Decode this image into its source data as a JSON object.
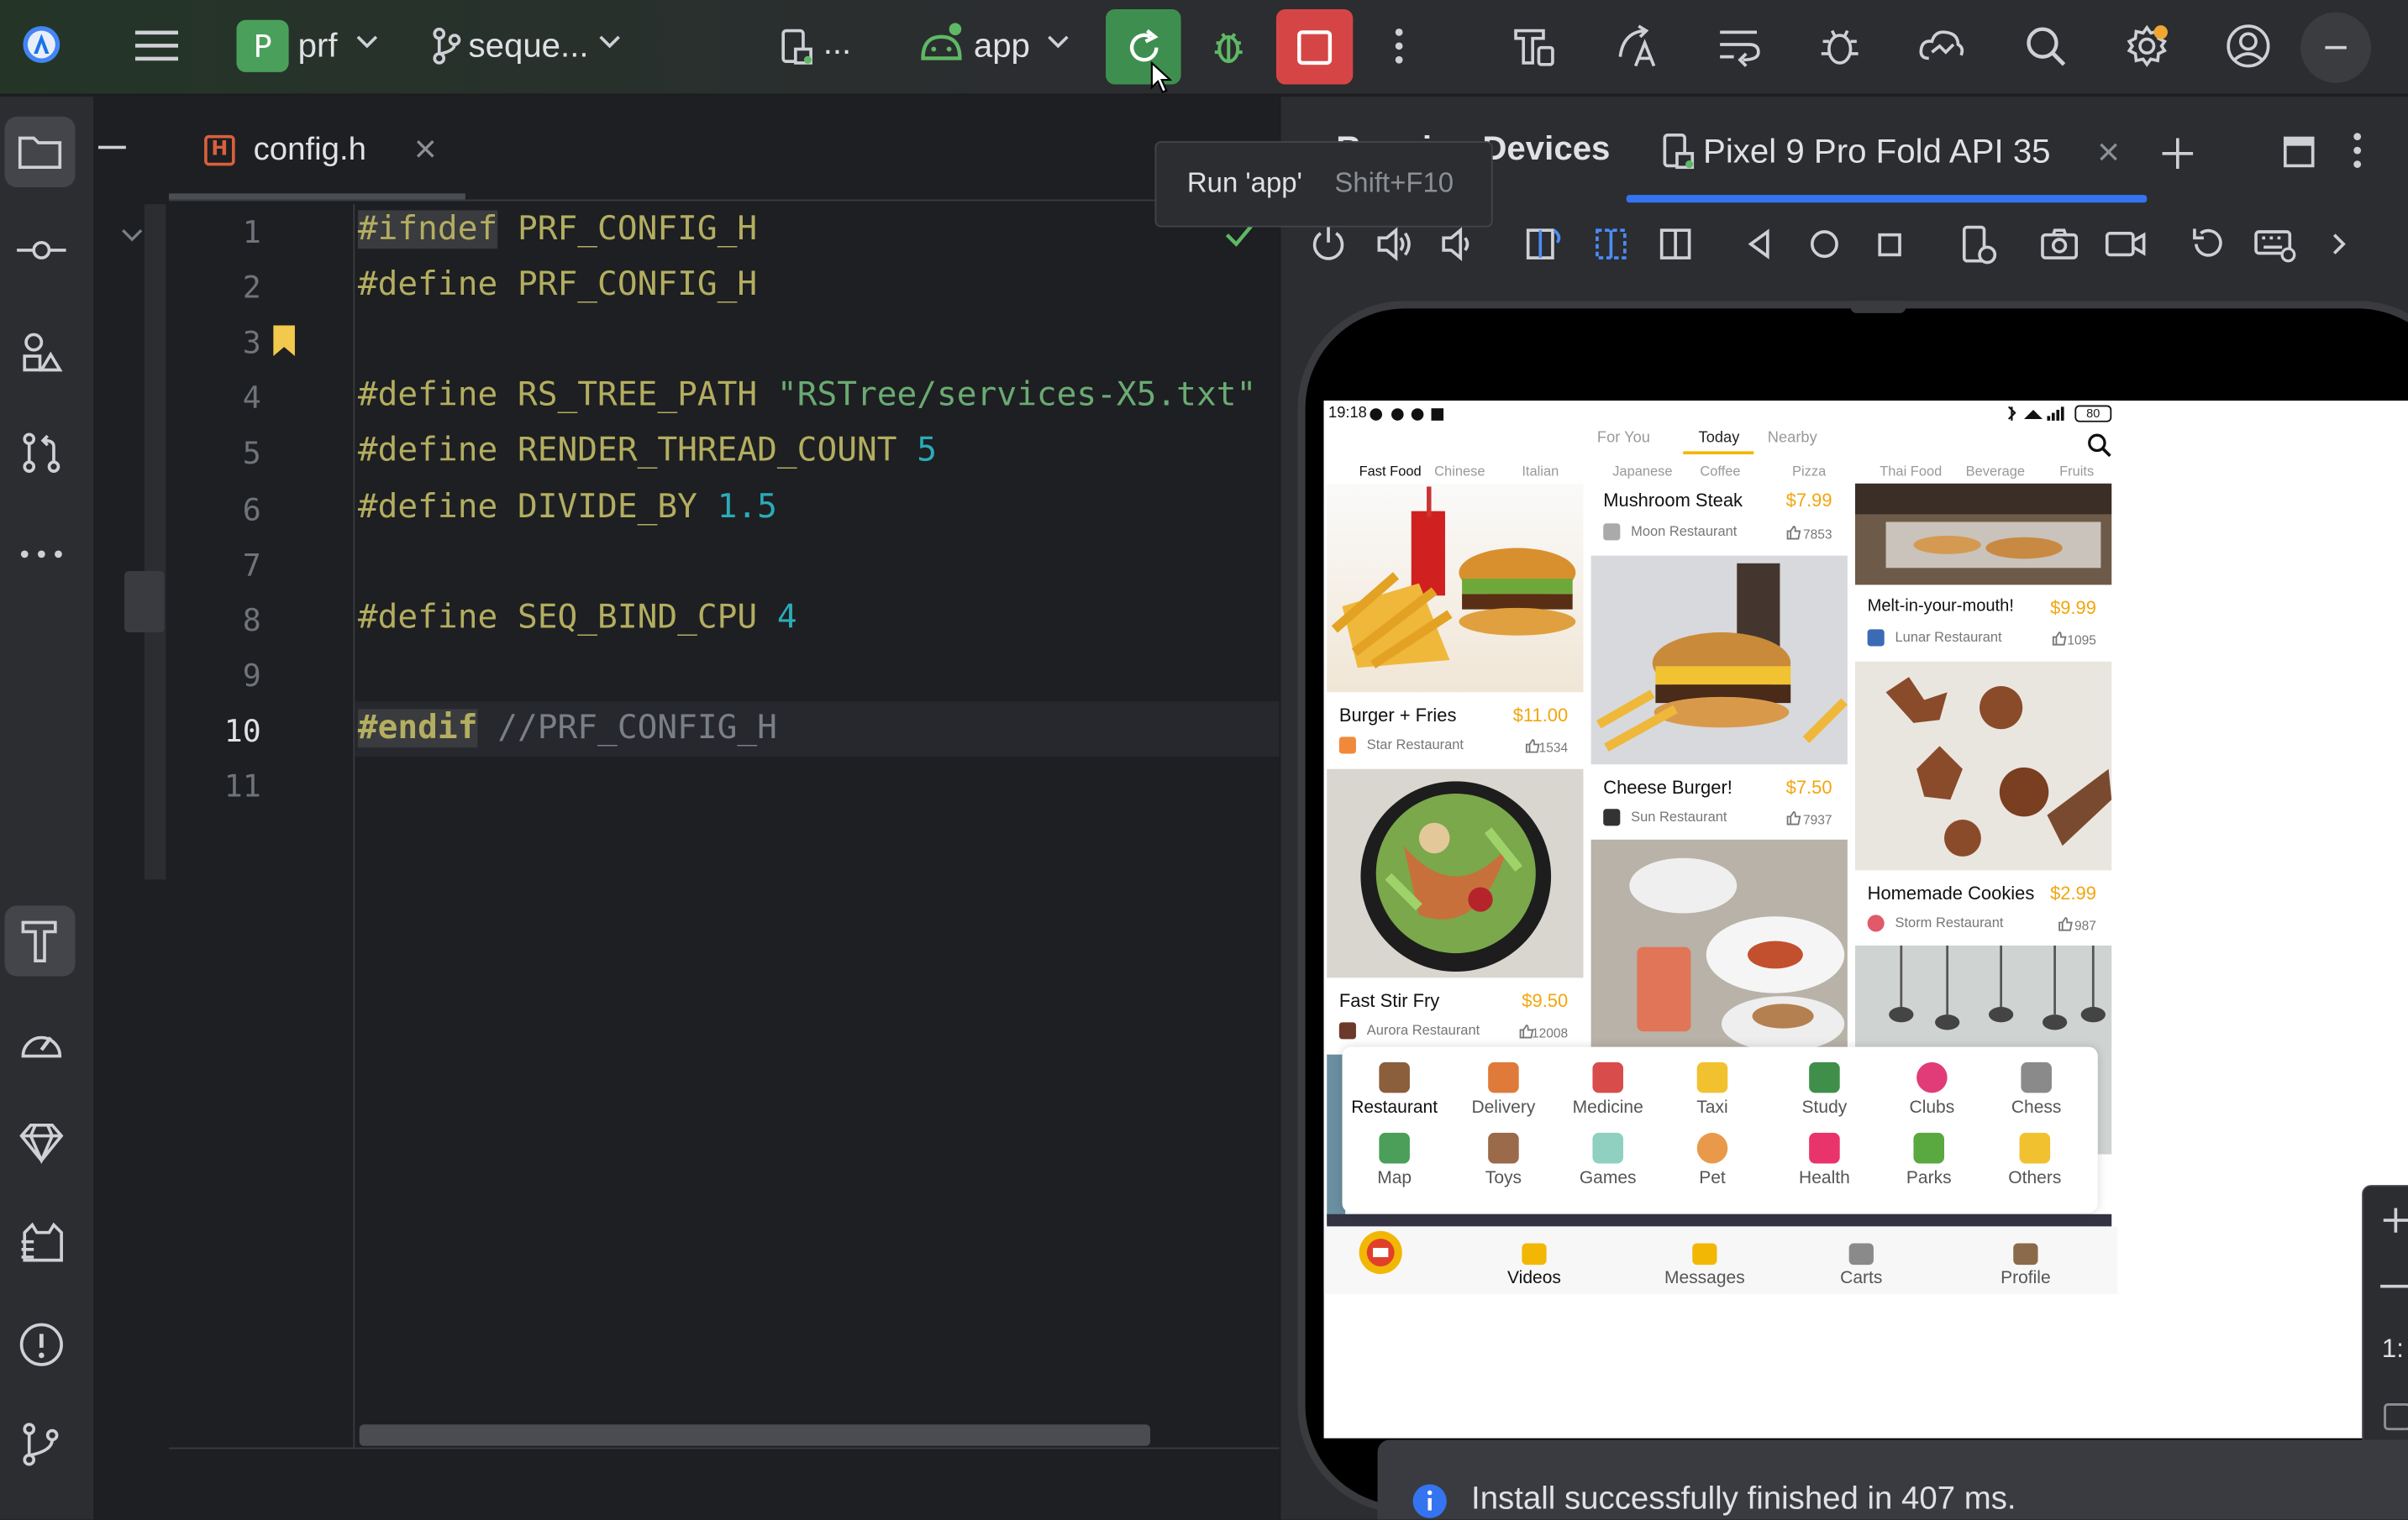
{
  "toolbar": {
    "project_badge": "P",
    "project": "prf",
    "branch": "seque...",
    "device_dots": "...",
    "run_config": "app"
  },
  "tooltip": {
    "label": "Run 'app'",
    "shortcut": "Shift+F10"
  },
  "editor": {
    "tab": "config.h",
    "tab_icon": "H",
    "line_numbers": [
      "1",
      "2",
      "3",
      "4",
      "5",
      "6",
      "7",
      "8",
      "9",
      "10",
      "11"
    ]
  },
  "code": {
    "l1_kw": "#ifndef",
    "l1_rest": " PRF_CONFIG_H",
    "l2_kw": "#define",
    "l2_rest": " PRF_CONFIG_H",
    "l4_kw": "#define",
    "l4_name": " RS_TREE_PATH ",
    "l4_str": "\"RSTree/services-X5.txt\"",
    "l5_kw": "#define",
    "l5_name": " RENDER_THREAD_COUNT ",
    "l5_num": "5",
    "l6_kw": "#define",
    "l6_name": " DIVIDE_BY ",
    "l6_num": "1.5",
    "l8_kw": "#define",
    "l8_name": " SEQ_BIND_CPU ",
    "l8_num": "4",
    "l10_kw": "#endif",
    "l10_cmt": " //PRF_CONFIG_H"
  },
  "devices": {
    "panel_title": "Running Devices",
    "device_tab": "Pixel 9 Pro Fold API 35"
  },
  "app": {
    "status_time": "19:18",
    "battery": "80",
    "top_tabs": [
      "For You",
      "Today",
      "Nearby"
    ],
    "categories": [
      "Fast Food",
      "Chinese",
      "Italian",
      "Japanese",
      "Coffee",
      "Pizza",
      "Thai Food",
      "Beverage",
      "Fruits"
    ],
    "cards": [
      {
        "title": "Burger + Fries",
        "price": "$11.00",
        "restaurant": "Star Restaurant",
        "likes": "1534"
      },
      {
        "title": "Fast Stir Fry",
        "price": "$9.50",
        "restaurant": "Aurora Restaurant",
        "likes": "12008"
      },
      {
        "title": "Mushroom Steak",
        "price": "$7.99",
        "restaurant": "Moon Restaurant",
        "likes": "7853"
      },
      {
        "title": "Cheese Burger!",
        "price": "$7.50",
        "restaurant": "Sun Restaurant",
        "likes": "7937"
      },
      {
        "title": "Melt-in-your-mouth!",
        "price": "$9.99",
        "restaurant": "Lunar Restaurant",
        "likes": "1095"
      },
      {
        "title": "Homemade Cookies",
        "price": "$2.99",
        "restaurant": "Storm Restaurant",
        "likes": "987"
      }
    ],
    "services": [
      "Restaurant",
      "Delivery",
      "Medicine",
      "Taxi",
      "Study",
      "Clubs",
      "Chess",
      "Map",
      "Toys",
      "Games",
      "Pet",
      "Health",
      "Parks",
      "Others"
    ],
    "bottom_nav": [
      "Videos",
      "Messages",
      "Carts",
      "Profile"
    ]
  },
  "side_zoom": "1:",
  "notification": "Install successfully finished in 407 ms.",
  "colors": {
    "run": "#3e8f4f",
    "stop": "#d64545",
    "accent": "#3574f0",
    "price": "#f2a60c"
  }
}
